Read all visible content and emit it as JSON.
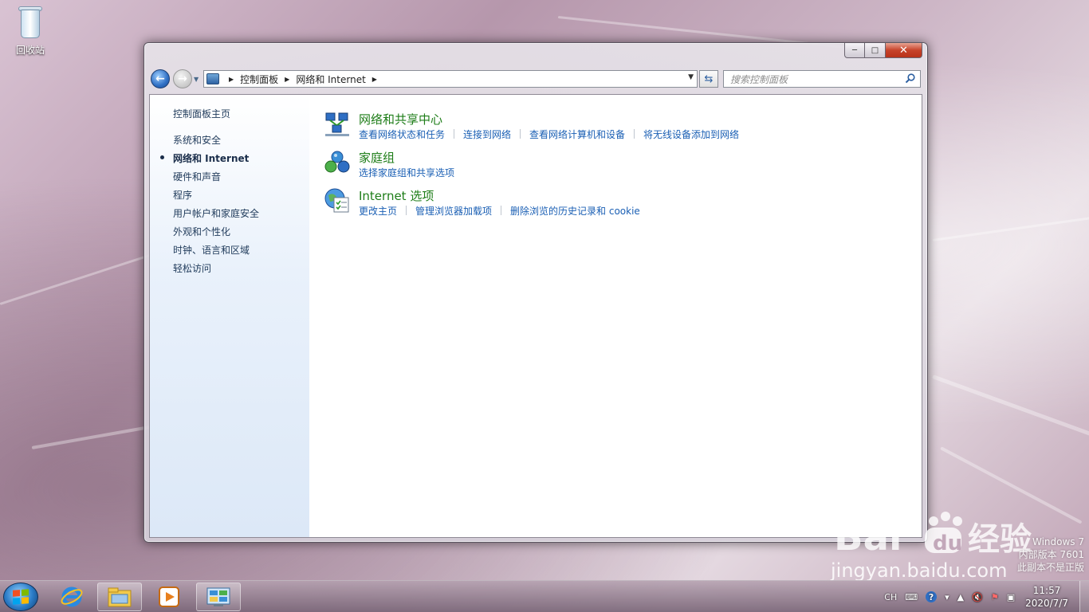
{
  "desktop": {
    "recycle_bin_label": "回收站",
    "watermark": {
      "os_name": "Windows 7",
      "build": "内部版本 7601",
      "notice": "此副本不是正版",
      "baidu_logo": "Bai du 经验",
      "baidu_url": "jingyan.baidu.com"
    }
  },
  "window": {
    "caption": {
      "minimize": "─",
      "maximize": "□",
      "close": "✕"
    },
    "nav": {
      "back_icon": "back-arrow-icon",
      "forward_icon": "forward-arrow-icon",
      "breadcrumb": [
        "控制面板",
        "网络和 Internet"
      ],
      "refresh_icon": "refresh-icon",
      "search_placeholder": "搜索控制面板"
    },
    "sidebar": {
      "home": "控制面板主页",
      "items": [
        "系统和安全",
        "网络和 Internet",
        "硬件和声音",
        "程序",
        "用户帐户和家庭安全",
        "外观和个性化",
        "时钟、语言和区域",
        "轻松访问"
      ],
      "active_index": 1
    },
    "categories": [
      {
        "title": "网络和共享中心",
        "icon": "network-sharing-center-icon",
        "links": [
          "查看网络状态和任务",
          "连接到网络",
          "查看网络计算机和设备",
          "将无线设备添加到网络"
        ]
      },
      {
        "title": "家庭组",
        "icon": "homegroup-icon",
        "links": [
          "选择家庭组和共享选项"
        ]
      },
      {
        "title": "Internet 选项",
        "icon": "internet-options-icon",
        "links": [
          "更改主页",
          "管理浏览器加载项",
          "删除浏览的历史记录和 cookie"
        ]
      }
    ]
  },
  "taskbar": {
    "start_icon": "windows-start-icon",
    "pinned": [
      "internet-explorer-icon",
      "windows-explorer-icon",
      "media-player-icon",
      "control-panel-icon"
    ],
    "tray": {
      "language": "CH",
      "time": "11:57",
      "date": "2020/7/7"
    }
  },
  "colors": {
    "link": "#1a5fb4",
    "category_title": "#1e7d18",
    "sidebar_text": "#1f3a5a"
  }
}
